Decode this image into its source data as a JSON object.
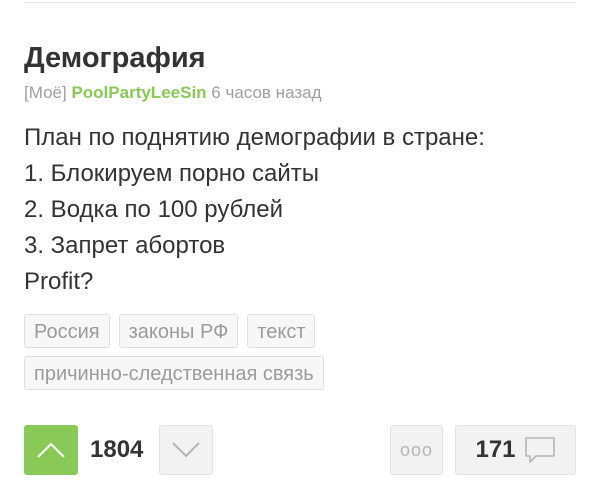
{
  "post": {
    "title": "Демография",
    "community": "[Моё]",
    "author": "PoolPartyLeeSin",
    "time": "6 часов назад",
    "body_lines": [
      "План по поднятию демографии в стране:",
      "1. Блокируем порно сайты",
      "2. Водка по 100 рублей",
      "3. Запрет абортов",
      "Profit?"
    ],
    "tags": [
      "Россия",
      "законы РФ",
      "текст",
      "причинно-следственная связь"
    ]
  },
  "actions": {
    "rating": "1804",
    "more_label": "ooo",
    "comments_count": "171"
  },
  "colors": {
    "accent": "#8ac858",
    "muted": "#a0a0a0"
  },
  "icons": {
    "upvote": "chevron-up-icon",
    "downvote": "chevron-down-icon",
    "comments": "speech-bubble-icon"
  }
}
